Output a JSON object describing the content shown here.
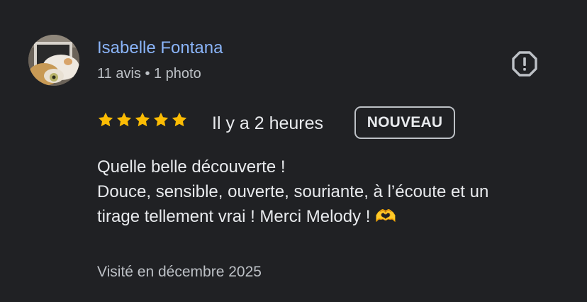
{
  "review": {
    "author_name": "Isabelle Fontana",
    "author_meta": "11 avis • 1 photo",
    "rating": 5,
    "rating_max": 5,
    "time_ago": "Il y a 2 heures",
    "badge": "NOUVEAU",
    "text_lines": [
      "Quelle belle découverte !",
      "Douce, sensible, ouverte, souriante, à l’écoute et un",
      "tirage tellement vrai ! Merci Melody ! 🫶"
    ],
    "visited": "Visité en décembre 2025"
  },
  "icons": {
    "report": "report-flag-icon",
    "star": "star-icon"
  },
  "colors": {
    "background": "#202124",
    "author_link": "#8ab4f8",
    "star": "#fbbc04",
    "text_primary": "#e8eaed",
    "text_secondary": "#bdc1c6"
  }
}
